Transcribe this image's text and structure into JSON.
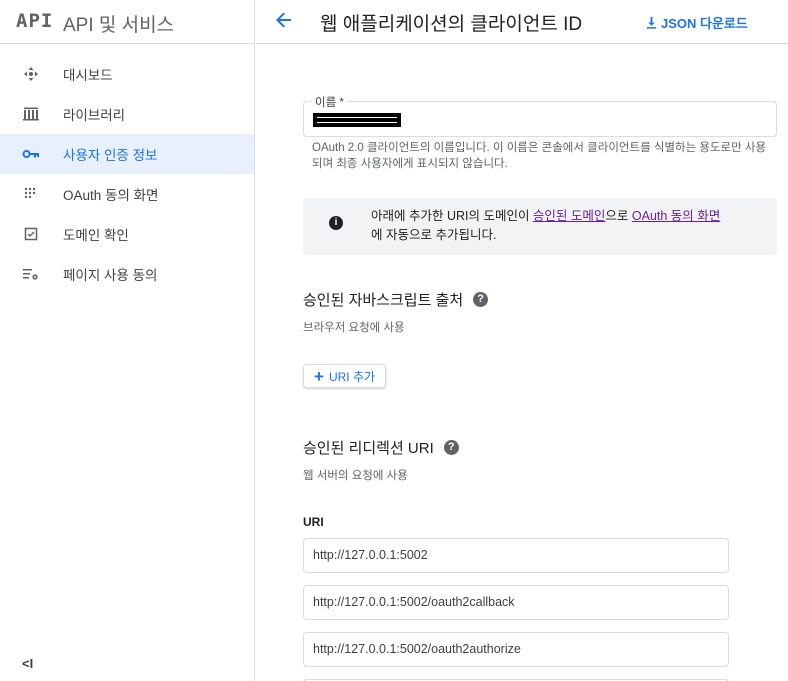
{
  "brand": {
    "logo": "API",
    "title": "API 및 서비스"
  },
  "sidebar": {
    "items": [
      {
        "label": "대시보드",
        "icon": "dashboard-icon"
      },
      {
        "label": "라이브러리",
        "icon": "library-icon"
      },
      {
        "label": "사용자 인증 정보",
        "icon": "key-icon",
        "active": true
      },
      {
        "label": "OAuth 동의 화면",
        "icon": "consent-icon"
      },
      {
        "label": "도메인 확인",
        "icon": "domain-check-icon"
      },
      {
        "label": "페이지 사용 동의",
        "icon": "settings-list-icon"
      }
    ],
    "collapse_label": "<I"
  },
  "header": {
    "title": "웹 애플리케이션의 클라이언트 ID",
    "json_download": "JSON 다운로드"
  },
  "form": {
    "name_label": "이름 *",
    "name_helper": "OAuth 2.0 클라이언트의 이름입니다. 이 이름은 콘솔에서 클라이언트를 식별하는 용도로만 사용되며 최종 사용자에게 표시되지 않습니다.",
    "notice": {
      "part1": "아래에 추가한 URI의 도메인이 ",
      "link1": "승인된 도메인",
      "part2": "으로 ",
      "link2": "OAuth 동의 화면",
      "part3": "에 자동으로 추가됩니다."
    },
    "js_origins": {
      "title": "승인된 자바스크립트 출처",
      "subtitle": "브라우저 요청에 사용",
      "add_label": "URI 추가"
    },
    "redirect_uris": {
      "title": "승인된 리디렉션 URI",
      "subtitle": "웹 서버의 요청에 사용",
      "uri_label": "URI",
      "values": [
        "http://127.0.0.1:5002",
        "http://127.0.0.1:5002/oauth2callback",
        "http://127.0.0.1:5002/oauth2authorize"
      ]
    }
  },
  "colors": {
    "accent": "#1a73e8",
    "active_bg": "#e8f0fe",
    "link_visited": "#681da8",
    "notice_bg": "#f1f3f4"
  }
}
